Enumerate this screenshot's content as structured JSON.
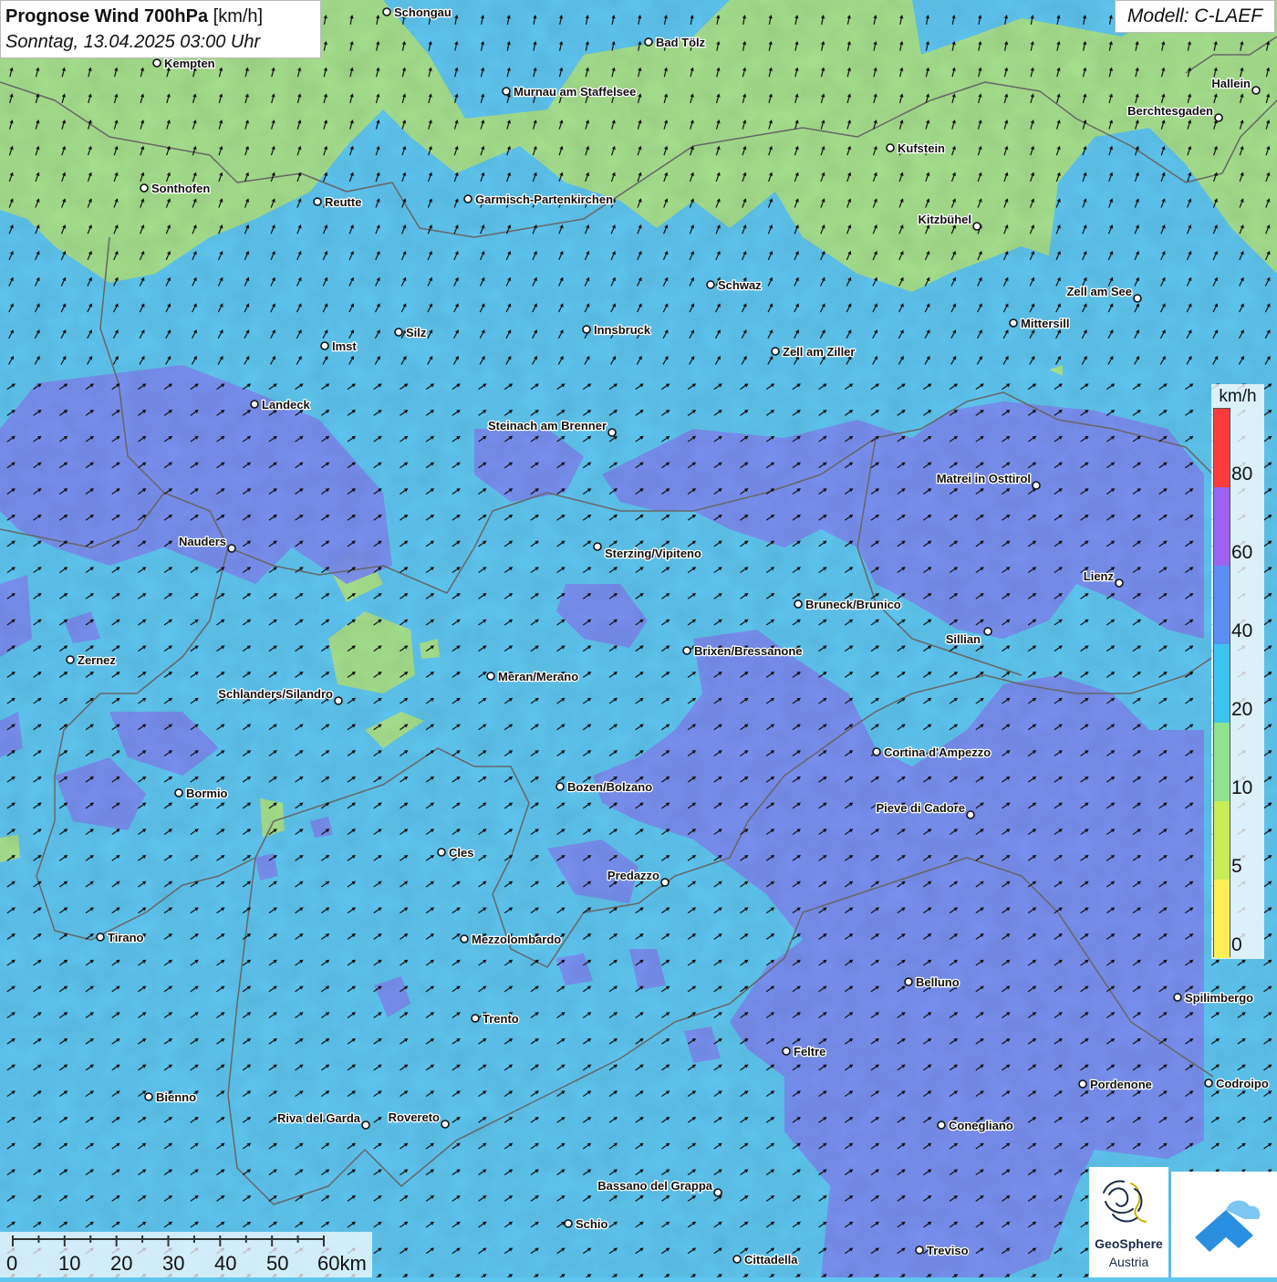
{
  "header": {
    "title_bold": "Prognose Wind 700hPa",
    "title_unit": " [km/h]",
    "datetime": "Sonntag, 13.04.2025 03:00 Uhr",
    "model": "Modell: C-LAEF"
  },
  "legend": {
    "unit": "km/h",
    "classes": [
      {
        "label": "0",
        "from": 0,
        "to": 5,
        "color": "#ffee55"
      },
      {
        "label": "5",
        "from": 5,
        "to": 10,
        "color": "#c8ec5a"
      },
      {
        "label": "10",
        "from": 10,
        "to": 20,
        "color": "#8fe38f"
      },
      {
        "label": "20",
        "from": 20,
        "to": 40,
        "color": "#3ec3f0"
      },
      {
        "label": "40",
        "from": 40,
        "to": 60,
        "color": "#5b8ef0"
      },
      {
        "label": "60",
        "from": 60,
        "to": 80,
        "color": "#9b63ee"
      },
      {
        "label": "80",
        "from": 80,
        "to": 100,
        "color": "#ff3b3b"
      }
    ]
  },
  "scale_bar": {
    "labels": [
      "0",
      "10",
      "20",
      "30",
      "40",
      "50",
      "60km"
    ]
  },
  "colors": {
    "base_wind": "#5fc6f0",
    "strong_wind": "#7a8ef0",
    "weak_wind": "#a6e08e",
    "border": "#666666",
    "arrow": "#111111"
  },
  "cities": [
    {
      "name": "Schongau",
      "label_pos": "right"
    },
    {
      "name": "Bad Tölz",
      "label_pos": "right"
    },
    {
      "name": "Kempten",
      "label_pos": "right"
    },
    {
      "name": "Murnau am Staffelsee",
      "label_pos": "right"
    },
    {
      "name": "Hallein",
      "label_pos": "left"
    },
    {
      "name": "Berchtesgaden",
      "label_pos": "left"
    },
    {
      "name": "Kufstein",
      "label_pos": "right"
    },
    {
      "name": "Sonthofen",
      "label_pos": "right"
    },
    {
      "name": "Reutte",
      "label_pos": "right"
    },
    {
      "name": "Garmisch-Partenkirchen",
      "label_pos": "right"
    },
    {
      "name": "Kitzbühel",
      "label_pos": "left"
    },
    {
      "name": "Schwaz",
      "label_pos": "right"
    },
    {
      "name": "Zell am See",
      "label_pos": "left"
    },
    {
      "name": "Mittersill",
      "label_pos": "right"
    },
    {
      "name": "Innsbruck",
      "label_pos": "right"
    },
    {
      "name": "Imst",
      "label_pos": "right"
    },
    {
      "name": "Silz",
      "label_pos": "right"
    },
    {
      "name": "Zell am Ziller",
      "label_pos": "right"
    },
    {
      "name": "Landeck",
      "label_pos": "right"
    },
    {
      "name": "Steinach am Brenner",
      "label_pos": "left"
    },
    {
      "name": "Matrei in Osttirol",
      "label_pos": "left"
    },
    {
      "name": "Nauders",
      "label_pos": "left"
    },
    {
      "name": "Sterzing/Vipiteno",
      "label_pos": "below-right"
    },
    {
      "name": "Lienz",
      "label_pos": "left"
    },
    {
      "name": "Bruneck/Brunico",
      "label_pos": "right"
    },
    {
      "name": "Sillian",
      "label_pos": "below-left"
    },
    {
      "name": "Zernez",
      "label_pos": "right"
    },
    {
      "name": "Brixen/Bressanone",
      "label_pos": "right"
    },
    {
      "name": "Meran/Merano",
      "label_pos": "right"
    },
    {
      "name": "Schlanders/Silandro",
      "label_pos": "left"
    },
    {
      "name": "Cortina d'Ampezzo",
      "label_pos": "right"
    },
    {
      "name": "Bozen/Bolzano",
      "label_pos": "right"
    },
    {
      "name": "Bormio",
      "label_pos": "right"
    },
    {
      "name": "Pieve di Cadore",
      "label_pos": "left"
    },
    {
      "name": "Cles",
      "label_pos": "right"
    },
    {
      "name": "Predazzo",
      "label_pos": "left"
    },
    {
      "name": "Tirano",
      "label_pos": "right"
    },
    {
      "name": "Mezzolombardo",
      "label_pos": "right"
    },
    {
      "name": "Belluno",
      "label_pos": "right"
    },
    {
      "name": "Spilimbergo",
      "label_pos": "right"
    },
    {
      "name": "Trento",
      "label_pos": "right"
    },
    {
      "name": "Feltre",
      "label_pos": "right"
    },
    {
      "name": "Pordenone",
      "label_pos": "right"
    },
    {
      "name": "Codroipo",
      "label_pos": "right"
    },
    {
      "name": "Bienno",
      "label_pos": "right"
    },
    {
      "name": "Riva del Garda",
      "label_pos": "left"
    },
    {
      "name": "Rovereto",
      "label_pos": "left"
    },
    {
      "name": "Conegliano",
      "label_pos": "right"
    },
    {
      "name": "Bassano del Grappa",
      "label_pos": "left"
    },
    {
      "name": "Schio",
      "label_pos": "right"
    },
    {
      "name": "Treviso",
      "label_pos": "right"
    },
    {
      "name": "Cittadella",
      "label_pos": "right"
    }
  ],
  "logo": {
    "name": "GeoSphere",
    "sub": "Austria"
  }
}
